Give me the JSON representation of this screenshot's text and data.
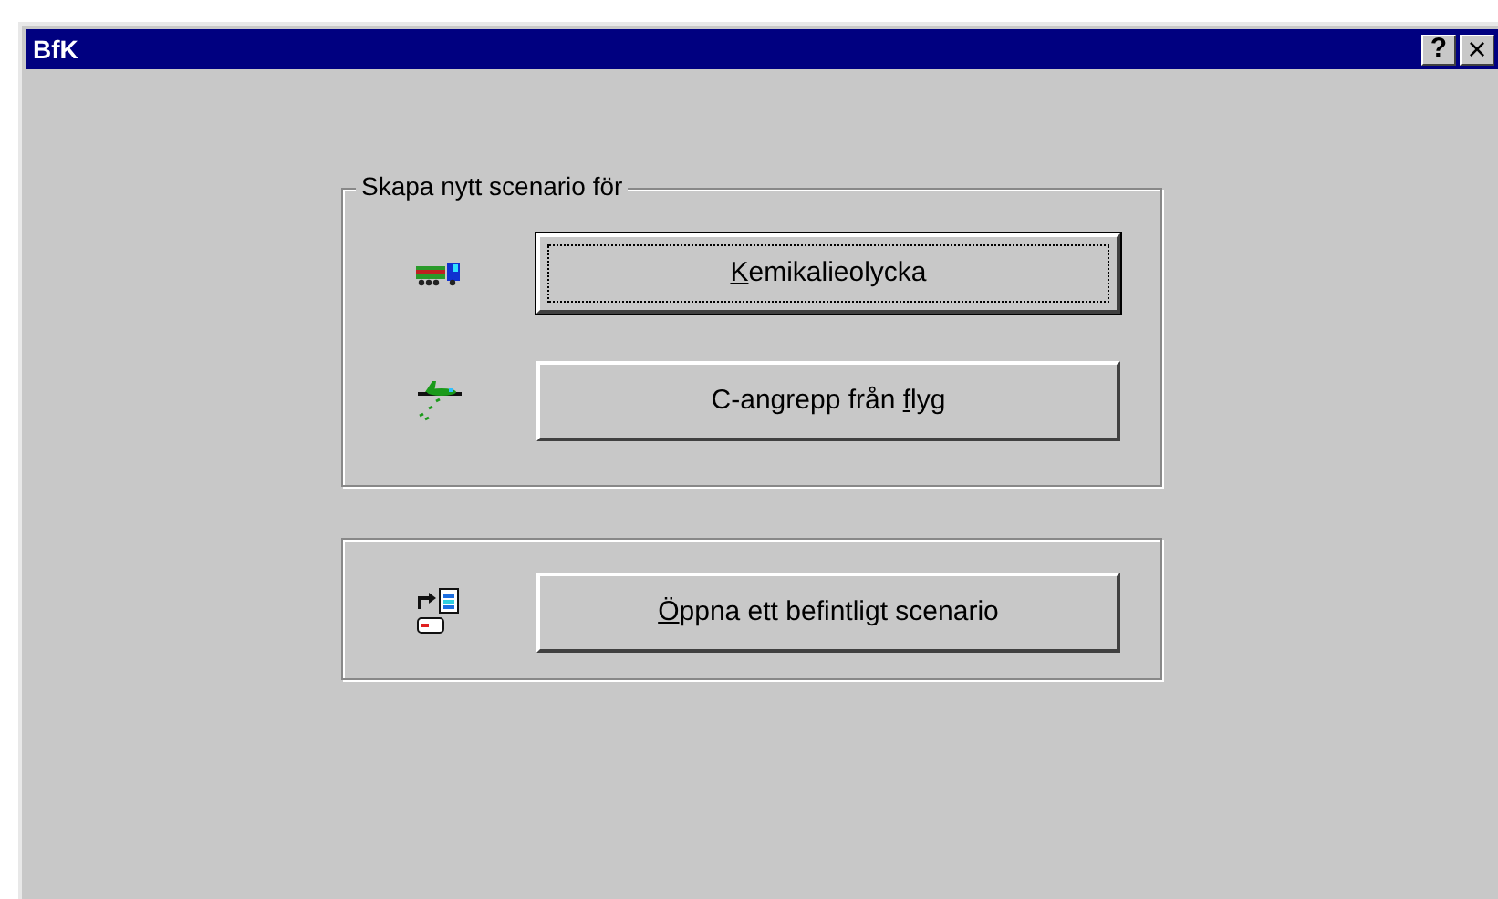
{
  "window": {
    "title": "BfK",
    "title_buttons": [
      {
        "kind": "help",
        "glyph": "?"
      },
      {
        "kind": "close",
        "glyph": "×"
      }
    ]
  },
  "groups": [
    {
      "legend": "Skapa nytt scenario för",
      "items": [
        {
          "kind": "truck",
          "default": true,
          "label": {
            "mnemonic": "K",
            "after": "emikalieolycka"
          }
        },
        {
          "kind": "plane",
          "default": false,
          "label": {
            "before": "C-angrepp från ",
            "mnemonic": "f",
            "after": "lyg"
          }
        }
      ]
    },
    {
      "items": [
        {
          "kind": "open",
          "default": false,
          "label": {
            "mnemonic": "Ö",
            "after": "ppna ett befintligt scenario"
          }
        }
      ]
    }
  ]
}
